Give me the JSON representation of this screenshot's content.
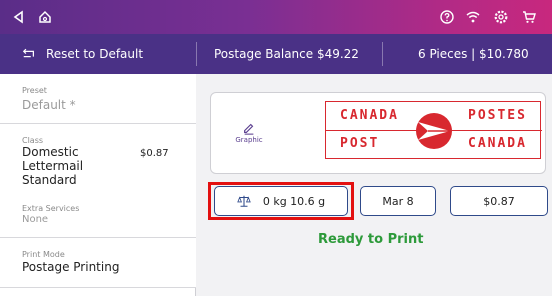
{
  "statusbar": {
    "icons": [
      "back-triangle-icon",
      "home-icon",
      "help-icon",
      "wifi-icon",
      "settings-icon",
      "cart-icon"
    ]
  },
  "actionbar": {
    "reset_label": "Reset to Default",
    "postage_balance": "Postage Balance $49.22",
    "pieces_summary": "6 Pieces | $10.780"
  },
  "sidebar": {
    "preset_label": "Preset",
    "preset_value": "Default *",
    "class_label": "Class",
    "class_value_line1": "Domestic",
    "class_value_line2": "Lettermail",
    "class_value_line3": "Standard",
    "class_price": "$0.87",
    "extra_services_label": "Extra Services",
    "extra_services_value": "None",
    "print_mode_label": "Print Mode",
    "print_mode_value": "Postage Printing"
  },
  "main": {
    "graphic_label": "Graphic",
    "stamp": {
      "top_left": "CANADA",
      "top_right": "POSTES",
      "bottom_left": "POST",
      "bottom_right": "CANADA"
    },
    "weight": "0 kg 10.6 g",
    "date": "Mar 8",
    "amount": "$0.87",
    "status": "Ready to Print"
  },
  "colors": {
    "accent": "#4a3186",
    "highlight": "#e31010",
    "ready": "#2d9a3a",
    "stamp_red": "#d8282f"
  }
}
